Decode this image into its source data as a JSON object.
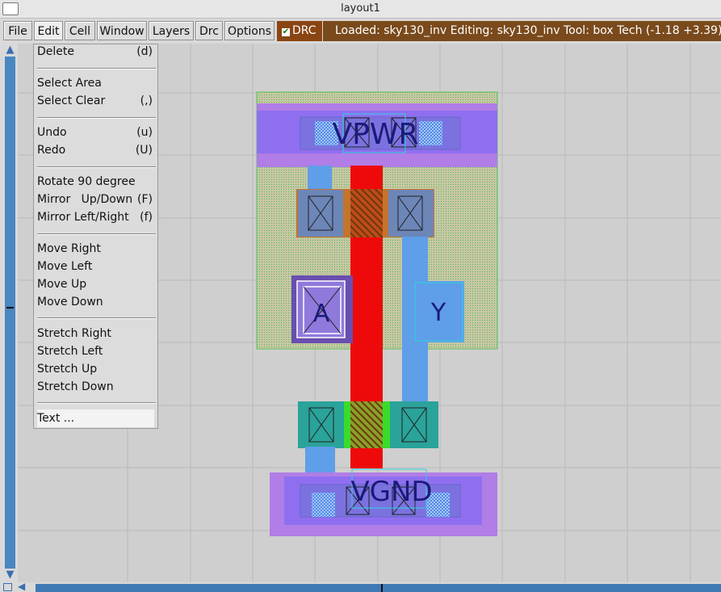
{
  "window": {
    "title": "layout1"
  },
  "menubar": {
    "items": [
      {
        "id": "file",
        "label": "File"
      },
      {
        "id": "edit",
        "label": "Edit"
      },
      {
        "id": "cell",
        "label": "Cell"
      },
      {
        "id": "window",
        "label": "Window"
      },
      {
        "id": "layers",
        "label": "Layers"
      },
      {
        "id": "drc_menu",
        "label": "Drc"
      },
      {
        "id": "options",
        "label": "Options"
      }
    ],
    "drc_toggle": {
      "label": "DRC",
      "checked": true
    },
    "status": "Loaded: sky130_inv Editing: sky130_inv Tool: box  Tech    (-1.18 +3.39) -"
  },
  "edit_menu": {
    "items": [
      {
        "label": "Delete",
        "accel": "(d)"
      },
      {
        "label": "Select Area",
        "accel": ""
      },
      {
        "label": "Select Clear",
        "accel": "(,)"
      },
      {
        "label": "Undo",
        "accel": "(u)"
      },
      {
        "label": "Redo",
        "accel": "(U)"
      },
      {
        "label": "Rotate 90 degree",
        "accel": ""
      },
      {
        "label": "Mirror   Up/Down",
        "accel": "(F)"
      },
      {
        "label": "Mirror Left/Right",
        "accel": "(f)"
      },
      {
        "label": "Move Right",
        "accel": ""
      },
      {
        "label": "Move Left",
        "accel": ""
      },
      {
        "label": "Move Up",
        "accel": ""
      },
      {
        "label": "Move Down",
        "accel": ""
      },
      {
        "label": "Stretch Right",
        "accel": ""
      },
      {
        "label": "Stretch Left",
        "accel": ""
      },
      {
        "label": "Stretch Up",
        "accel": ""
      },
      {
        "label": "Stretch Down",
        "accel": ""
      },
      {
        "label": "Text ...",
        "accel": ""
      }
    ]
  },
  "layout": {
    "labels": {
      "vpwr": "VPWR",
      "vgnd": "VGND",
      "input": "A",
      "output": "Y"
    }
  }
}
